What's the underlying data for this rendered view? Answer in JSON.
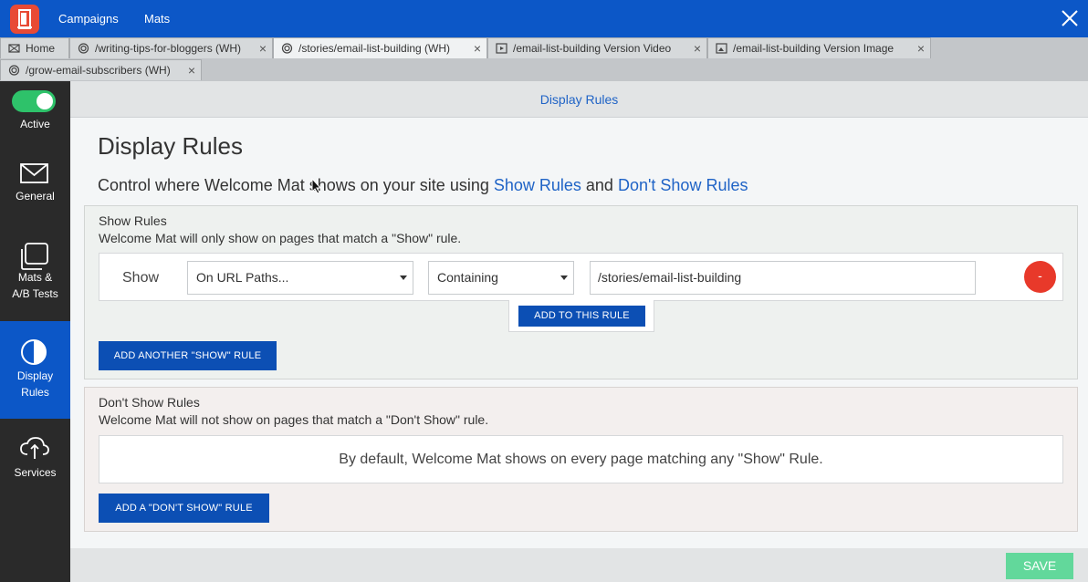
{
  "topbar": {
    "nav": [
      "Campaigns",
      "Mats"
    ],
    "colors": {
      "bar": "#0c57c7",
      "logo": "#e84a35"
    }
  },
  "tabs": [
    {
      "label": "Home",
      "icon": "home-icon",
      "active": false
    },
    {
      "label": "/writing-tips-for-bloggers (WH)",
      "icon": "target-icon",
      "active": false
    },
    {
      "label": "/stories/email-list-building (WH)",
      "icon": "target-icon",
      "active": true
    },
    {
      "label": "/email-list-building Version Video",
      "icon": "video-icon",
      "active": false
    },
    {
      "label": "/email-list-building Version Image",
      "icon": "image-icon",
      "active": false
    },
    {
      "label": "/grow-email-subscribers (WH)",
      "icon": "target-icon",
      "active": false
    }
  ],
  "sidebar": {
    "items": [
      {
        "label": "Active",
        "icon": "toggle-switch"
      },
      {
        "label": "General",
        "icon": "envelope-icon"
      },
      {
        "label1": "Mats &",
        "label2": "A/B Tests",
        "icon": "layers-icon"
      },
      {
        "label1": "Display",
        "label2": "Rules",
        "icon": "half-circle-icon",
        "active": true
      },
      {
        "label": "Services",
        "icon": "cloud-upload-icon"
      }
    ]
  },
  "panel": {
    "header": "Display Rules"
  },
  "main": {
    "title": "Display Rules",
    "subtitle_pre": "Control where Welcome Mat shows on your site using ",
    "subtitle_link1": "Show Rules",
    "subtitle_mid": " and ",
    "subtitle_link2": "Don't Show Rules"
  },
  "show_rules": {
    "title": "Show Rules",
    "description": "Welcome Mat will only show on pages that match a \"Show\" rule.",
    "rule": {
      "label": "Show",
      "type_select": "On URL Paths...",
      "match_select": "Containing",
      "value": "/stories/email-list-building",
      "remove": "-"
    },
    "add_to_rule": "ADD TO THIS RULE",
    "add_another": "ADD ANOTHER \"SHOW\" RULE"
  },
  "dont_show_rules": {
    "title": "Don't Show Rules",
    "description": "Welcome Mat will not show on pages that match a \"Don't Show\" rule.",
    "default_message": "By default, Welcome Mat shows on every page matching any \"Show\" Rule.",
    "add_button": "ADD A \"DON'T SHOW\" RULE"
  },
  "footer": {
    "save": "SAVE"
  }
}
